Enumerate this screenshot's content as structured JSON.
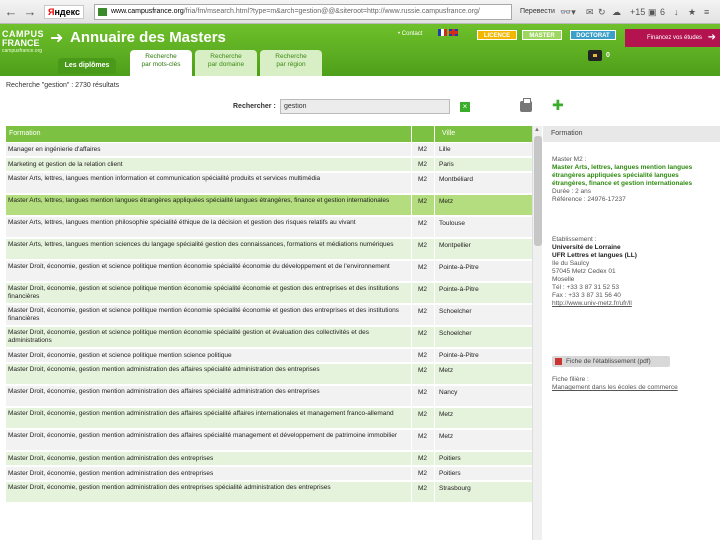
{
  "browser": {
    "yandex": "Яндекс",
    "url_domain": "www.campusfrance.org",
    "url_path": "/fria/fm/msearch.html?type=m&arch=gestion@@&siteroot=http://www.russie.campusfrance.org/",
    "translate_label": "Перевести",
    "badge_count": "+15",
    "badge_count2": "6"
  },
  "header": {
    "logo_line1": "CAMPUS",
    "logo_line2": "FRANCE",
    "logo_line3": "campusfrance.org",
    "title": "Annuaire des Masters",
    "contact": "• Contact",
    "licence": "LICENCE",
    "master": "MASTER",
    "doctorat": "DOCTORAT",
    "finance": "Financez vos études",
    "cart_count": "0"
  },
  "tabs": {
    "diplomes": "Les diplômes",
    "t1_line1": "Recherche",
    "t1_line2": "par mots-clés",
    "t2_line1": "Recherche",
    "t2_line2": "par domaine",
    "t3_line1": "Recherche",
    "t3_line2": "par région"
  },
  "search": {
    "results": "Recherche \"gestion\" : 2730 résultats",
    "label": "Rechercher :",
    "value": "gestion",
    "clear": "×"
  },
  "table": {
    "col_formation": "Formation",
    "col_ville": "Ville",
    "colors": {
      "header": "#7dc142",
      "row_odd": "#f2f2f2",
      "row_even": "#e6f3dc",
      "row_selected": "#b3dd7e"
    },
    "rows": [
      {
        "formation": "Manager en ingénierie d'affaires",
        "level": "M2",
        "ville": "Lille"
      },
      {
        "formation": "Marketing et gestion de la relation client",
        "level": "M2",
        "ville": "Paris"
      },
      {
        "formation": "Master Arts, lettres, langues mention information et communication spécialité produits et services multimédia",
        "level": "M2",
        "ville": "Montbéliard"
      },
      {
        "formation": "Master Arts, lettres, langues mention langues étrangères appliquées spécialité langues étrangères, finance et gestion internationales",
        "level": "M2",
        "ville": "Metz"
      },
      {
        "formation": "Master Arts, lettres, langues mention philosophie spécialité éthique de la décision et gestion des risques relatifs au vivant",
        "level": "M2",
        "ville": "Toulouse"
      },
      {
        "formation": "Master Arts, lettres, langues mention sciences du langage spécialité gestion des connaissances, formations et médiations numériques",
        "level": "M2",
        "ville": "Montpellier"
      },
      {
        "formation": "Master Droit, économie, gestion et science politique mention économie spécialité économie du développement et de l'environnement",
        "level": "M2",
        "ville": "Pointe-à-Pitre"
      },
      {
        "formation": "Master Droit, économie, gestion et science politique mention économie spécialité économie et gestion des entreprises et des institutions financières",
        "level": "M2",
        "ville": "Pointe-à-Pitre"
      },
      {
        "formation": "Master Droit, économie, gestion et science politique mention économie spécialité économie et gestion des entreprises et des institutions financières",
        "level": "M2",
        "ville": "Schoelcher"
      },
      {
        "formation": "Master Droit, économie, gestion et science politique mention économie spécialité gestion et évaluation des collectivités et des administrations",
        "level": "M2",
        "ville": "Schoelcher"
      },
      {
        "formation": "Master Droit, économie, gestion et science politique mention science politique",
        "level": "M2",
        "ville": "Pointe-à-Pitre"
      },
      {
        "formation": "Master Droit, économie, gestion mention administration des affaires spécialité administration des entreprises",
        "level": "M2",
        "ville": "Metz"
      },
      {
        "formation": "Master Droit, économie, gestion mention administration des affaires spécialité administration des entreprises",
        "level": "M2",
        "ville": "Nancy"
      },
      {
        "formation": "Master Droit, économie, gestion mention administration des affaires spécialité affaires internationales et management franco-allemand",
        "level": "M2",
        "ville": "Metz"
      },
      {
        "formation": "Master Droit, économie, gestion mention administration des affaires spécialité management et développement de patrimoine immobilier",
        "level": "M2",
        "ville": "Metz"
      },
      {
        "formation": "Master Droit, économie, gestion mention administration des entreprises",
        "level": "M2",
        "ville": "Poitiers"
      },
      {
        "formation": "Master Droit, économie, gestion mention administration des entreprises",
        "level": "M2",
        "ville": "Poitiers"
      },
      {
        "formation": "Master Droit, économie, gestion mention administration des entreprises spécialité administration des entreprises",
        "level": "M2",
        "ville": "Strasbourg"
      }
    ]
  },
  "panel": {
    "title": "Formation",
    "m2": "Master M2 :",
    "name": "Master Arts, lettres, langues mention langues étrangères appliquées spécialité langues étrangères, finance et gestion internationales",
    "duree": "Durée : 2 ans",
    "reference": "Référence : 24976-17237",
    "etab_label": "Etablissement :",
    "univ": "Université de Lorraine",
    "ufr": "UFR Lettres et langues (LL)",
    "addr1": "Ile du Saulcy",
    "addr2": "57045 Metz Cedex 01",
    "addr3": "Moselle",
    "tel": "Tél : +33 3 87 31 52 53",
    "fax": "Fax : +33 3 87 31 56 40",
    "site": "http://www.univ-metz.fr/ufr/ll",
    "fiche_btn": "Fiche de l'établissement (pdf)",
    "filiere_label": "Fiche filière :",
    "filiere_link": "Management dans les écoles de commerce"
  }
}
